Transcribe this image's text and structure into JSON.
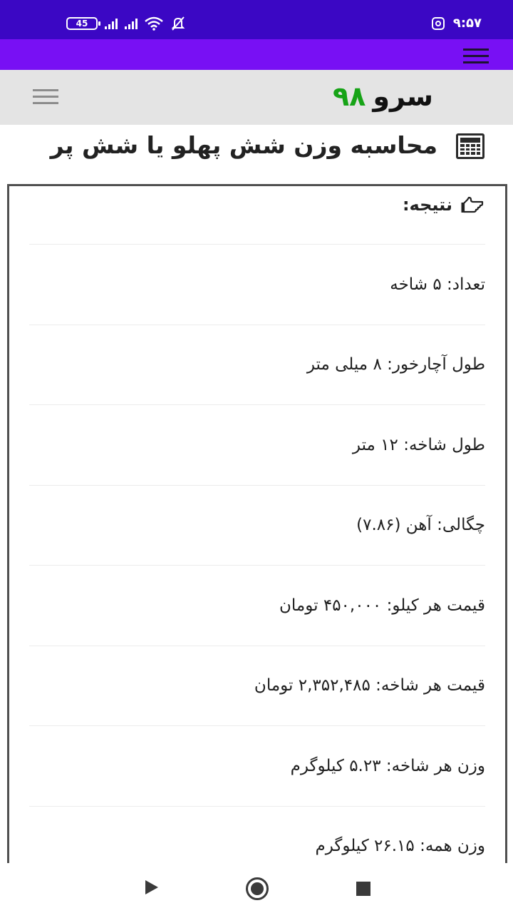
{
  "status_bar": {
    "battery": "45",
    "time": "۹:۵۷",
    "icons": [
      "battery-icon",
      "signal-icon",
      "signal-icon",
      "wifi-icon",
      "bell-muted-icon",
      "instagram-icon"
    ]
  },
  "header": {
    "logo_text": "سرو",
    "logo_number": "۹۸",
    "menu_icon": "hamburger-icon"
  },
  "page": {
    "title": "محاسبه وزن شش پهلو یا شش پر",
    "title_icon": "calculator-icon"
  },
  "result": {
    "label": "نتیجه:",
    "icon": "hand-pointing-icon",
    "rows": [
      "تعداد: ۵ شاخه",
      "طول آچارخور: ۸ میلی متر",
      "طول شاخه: ۱۲ متر",
      "چگالی: آهن (۷.۸۶)",
      "قیمت هر کیلو: ۴۵۰,۰۰۰ تومان",
      "قیمت هر شاخه: ۲,۳۵۲,۴۸۵ تومان",
      "وزن هر شاخه: ۵.۲۳ کیلوگرم",
      "وزن همه: ۲۶.۱۵ کیلوگرم"
    ]
  },
  "colors": {
    "status_bar": "#3b07c4",
    "app_bar": "#7810f4",
    "header_bg": "#e4e4e4",
    "logo_number": "#16a316"
  }
}
